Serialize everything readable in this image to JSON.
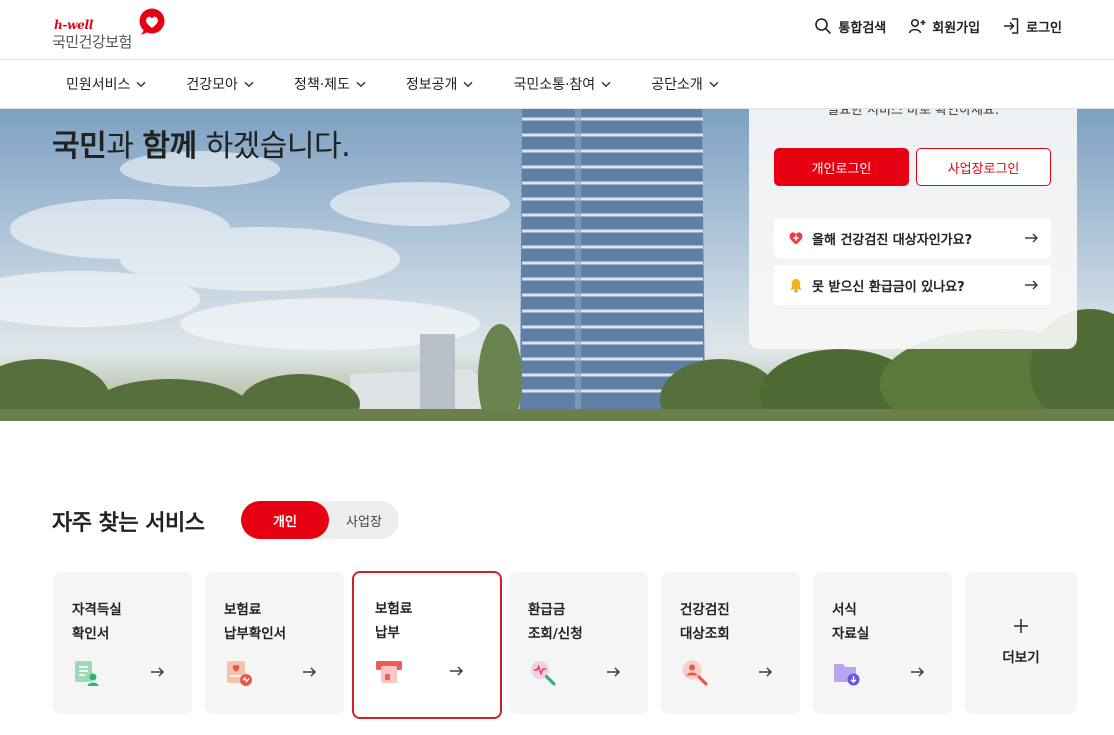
{
  "header": {
    "logo": {
      "tagline": "h-well",
      "name": "국민건강보험"
    },
    "utility": [
      {
        "label": "통합검색",
        "icon": "search-icon"
      },
      {
        "label": "회원가입",
        "icon": "user-add-icon"
      },
      {
        "label": "로그인",
        "icon": "login-icon"
      }
    ]
  },
  "gnb": {
    "items": [
      {
        "label": "민원서비스"
      },
      {
        "label": "건강모아"
      },
      {
        "label": "정책·제도"
      },
      {
        "label": "정보공개"
      },
      {
        "label": "국민소통·참여"
      },
      {
        "label": "공단소개"
      }
    ]
  },
  "hero": {
    "headline_bold1": "국민",
    "headline_mid1": "과 ",
    "headline_bold2": "함께",
    "headline_mid2": " 하겠습니다."
  },
  "login_card": {
    "partial_text": "필요한 서비스 바로 확인하세요.",
    "personal_login": "개인로그인",
    "business_login": "사업장로그인",
    "links": [
      {
        "label": "올해 건강검진 대상자인가요?",
        "icon": "heart-icon"
      },
      {
        "label": "못 받으신 환급금이 있나요?",
        "icon": "bell-icon"
      }
    ]
  },
  "services": {
    "title": "자주 찾는 서비스",
    "toggle": {
      "active": "개인",
      "inactive": "사업장"
    },
    "cards": [
      {
        "line1": "자격득실",
        "line2": "확인서",
        "icon": "certificate-icon"
      },
      {
        "line1": "보험료",
        "line2": "납부확인서",
        "icon": "payment-document-icon"
      },
      {
        "line1": "보험료",
        "line2": "납부",
        "icon": "card-payment-icon"
      },
      {
        "line1": "환급금",
        "line2": "조회/신청",
        "icon": "refund-search-icon"
      },
      {
        "line1": "건강검진",
        "line2": "대상조회",
        "icon": "person-search-icon"
      },
      {
        "line1": "서식",
        "line2": "자료실",
        "icon": "folder-download-icon"
      }
    ],
    "more_label": "더보기"
  },
  "colors": {
    "brand_red": "#e60012",
    "card_bg": "#f5f5f5",
    "active_border": "#d0202a"
  }
}
